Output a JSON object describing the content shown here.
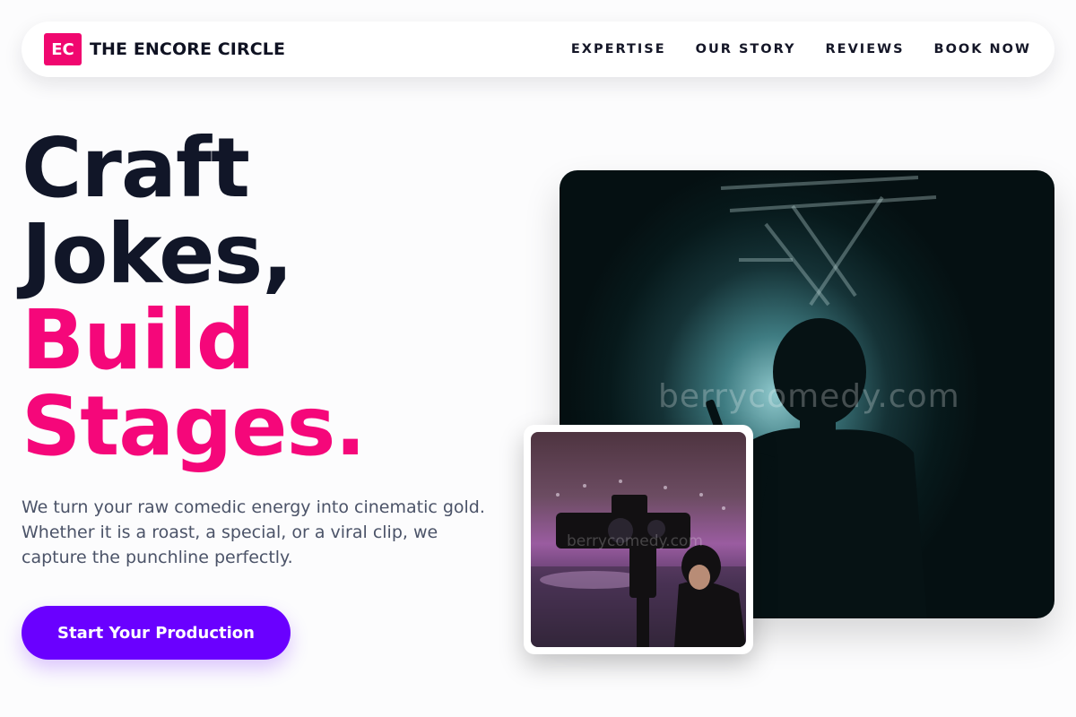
{
  "brand": {
    "logo_initials": "EC",
    "name": "THE ENCORE CIRCLE",
    "accent_color": "#f0076f"
  },
  "nav": {
    "links": [
      {
        "label": "EXPERTISE"
      },
      {
        "label": "OUR STORY"
      },
      {
        "label": "REVIEWS"
      },
      {
        "label": "BOOK NOW"
      }
    ]
  },
  "hero": {
    "title_lines": [
      "Craft",
      "Jokes,",
      "Build",
      "Stages."
    ],
    "title_dark_color": "#111628",
    "title_accent_color": "#f5077a",
    "description": "We turn your raw comedic energy into cinematic gold. Whether it is a roast, a special, or a viral clip, we capture the punchline perfectly.",
    "cta_label": "Start Your Production",
    "cta_color": "#6a00ff"
  },
  "images": {
    "main": {
      "icon": "silhouette-performer-stage-photo",
      "watermark": "berrycomedy.com"
    },
    "inset": {
      "icon": "camera-operator-photo",
      "watermark": "berrycomedy.com"
    }
  }
}
